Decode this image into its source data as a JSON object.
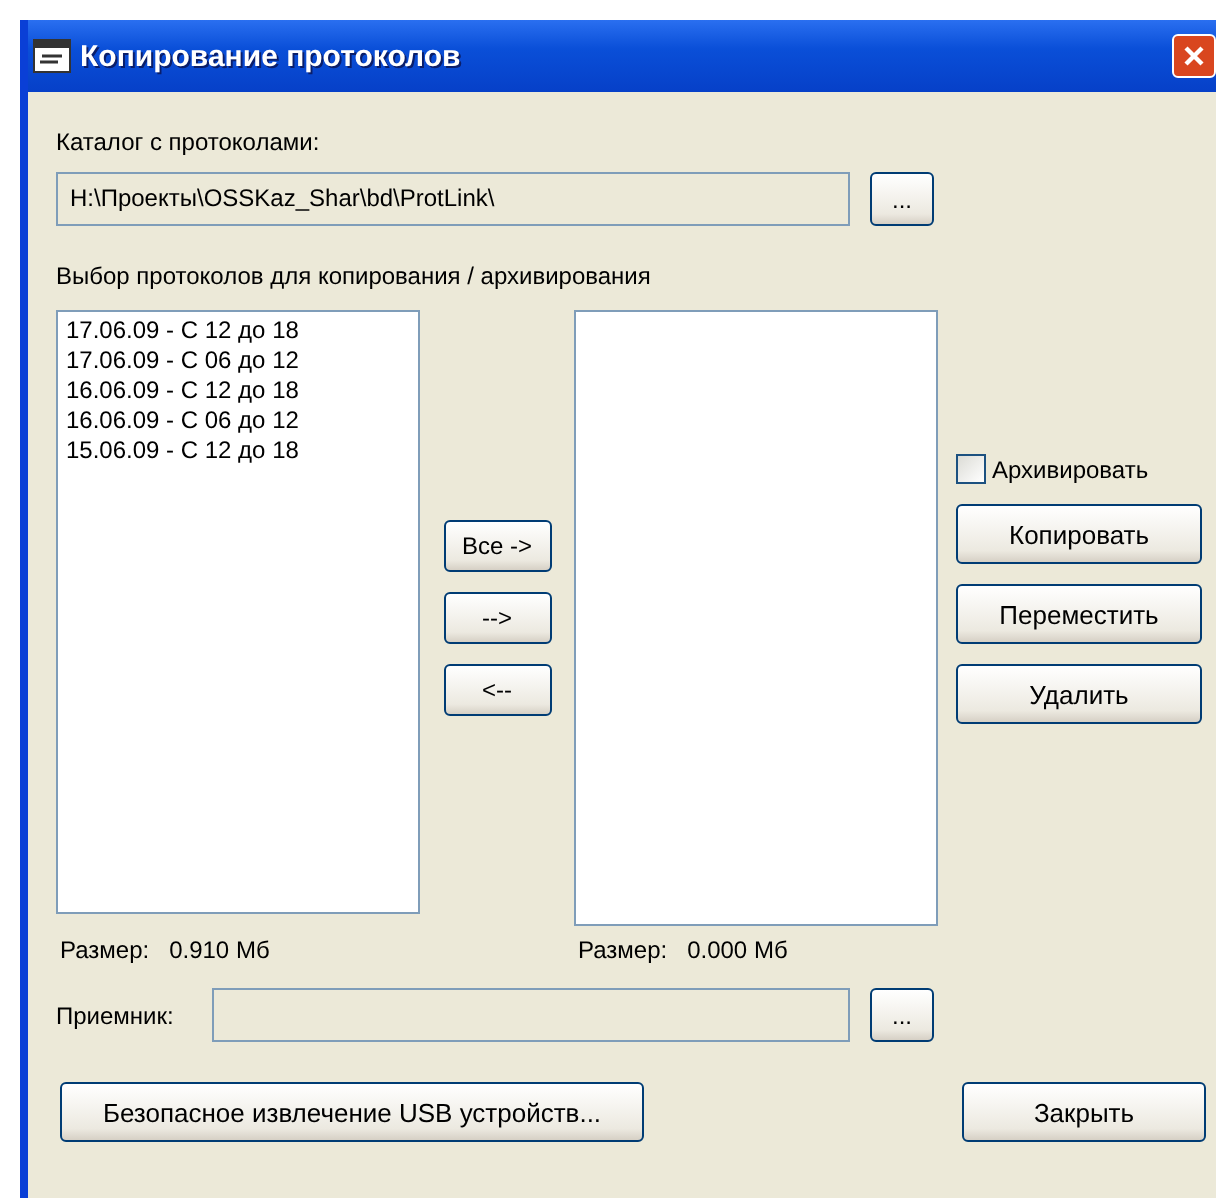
{
  "window": {
    "title": "Копирование протоколов"
  },
  "catalog": {
    "label": "Каталог с протоколами:",
    "value": "H:\\Проекты\\OSSKaz_Shar\\bd\\ProtLink\\",
    "browse": "..."
  },
  "selection_label": "Выбор протоколов для копирования / архивирования",
  "source_list": {
    "items": [
      "17.06.09 - С 12 до 18",
      "17.06.09 - С 06 до 12",
      "16.06.09 - С 12 до 18",
      "16.06.09 - С 06 до 12",
      "15.06.09 - С 12 до 18"
    ],
    "size_label": "Размер:",
    "size": "0.910 Мб"
  },
  "move_buttons": [
    "Все ->",
    "-->",
    "<--"
  ],
  "target_list": {
    "size_label": "Размер:",
    "size": "0.000 Мб"
  },
  "archive": {
    "label": "Архивировать",
    "checked": false
  },
  "action_buttons": [
    "Копировать",
    "Переместить",
    "Удалить"
  ],
  "receiver": {
    "label": "Приемник:",
    "browse": "..."
  },
  "footer_buttons": [
    "Безопасное извлечение USB устройств...",
    "Закрыть"
  ]
}
